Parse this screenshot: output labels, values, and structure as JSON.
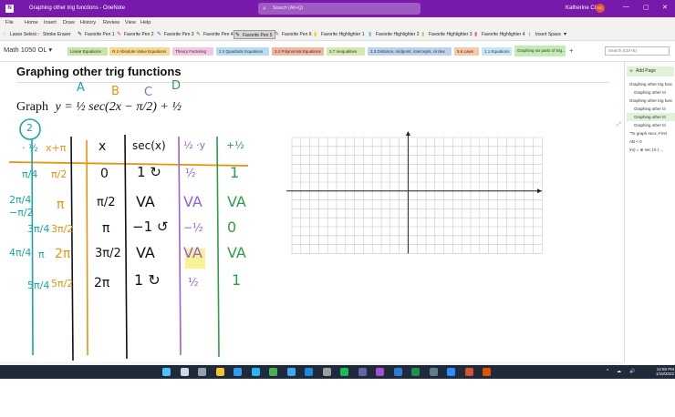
{
  "window": {
    "title": "Graphing other trig functions - OneNote",
    "app_badge": "N",
    "search_placeholder": "Search (Alt+Q)",
    "user": "Katherine Cliff",
    "user_initials": "KC",
    "minimize_glyph": "—",
    "maximize_glyph": "▢",
    "close_glyph": "✕"
  },
  "menu": [
    "File",
    "Home",
    "Insert",
    "Draw",
    "History",
    "Review",
    "View",
    "Help"
  ],
  "toolbar": {
    "tools": [
      {
        "label": "Lasso Select",
        "icon": "lasso-icon",
        "glyph": "◌",
        "color": "#444444"
      },
      {
        "label": "Stroke Eraser",
        "icon": "eraser-icon",
        "glyph": "▱",
        "color": "#d9534f"
      },
      {
        "label": "Favorite Pen 1",
        "icon": "pen-icon",
        "glyph": "✎",
        "color": "#111111"
      },
      {
        "label": "Favorite Pen 2",
        "icon": "pen-icon",
        "glyph": "✎",
        "color": "#c0392b"
      },
      {
        "label": "Favorite Pen 3",
        "icon": "pen-icon",
        "glyph": "✎",
        "color": "#1565c0"
      },
      {
        "label": "Favorite Pen 4",
        "icon": "pen-icon",
        "glyph": "✎",
        "color": "#2e7d32"
      },
      {
        "label": "Favorite Pen 5",
        "icon": "pen-icon",
        "glyph": "✎",
        "color": "#111111",
        "selected": true
      },
      {
        "label": "Favorite Pen 6",
        "icon": "pen-icon",
        "glyph": "✎",
        "color": "#c0392b"
      },
      {
        "label": "Favorite Highlighter 1",
        "icon": "highlighter-icon",
        "glyph": "▮",
        "color": "#f2d600"
      },
      {
        "label": "Favorite Highlighter 2",
        "icon": "highlighter-icon",
        "glyph": "▮",
        "color": "#5ec8f2"
      },
      {
        "label": "Favorite Highlighter 3",
        "icon": "highlighter-icon",
        "glyph": "▮",
        "color": "#9be15d"
      },
      {
        "label": "Favorite Highlighter 4",
        "icon": "highlighter-icon",
        "glyph": "▮",
        "color": "#f06292"
      },
      {
        "label": "Insert Space",
        "icon": "insert-space-icon",
        "glyph": "↕",
        "color": "#444444"
      }
    ],
    "more_glyph": "▾"
  },
  "notebook": {
    "title": "Math 1050 OL",
    "dropdown_glyph": "▾",
    "sections": [
      {
        "label": "Linear Equations",
        "color": "#c9e3a8"
      },
      {
        "label": "R.2 Absolute Value Equations",
        "color": "#f6d98a"
      },
      {
        "label": "Theory Factoring",
        "color": "#f5c6e0"
      },
      {
        "label": "2.2 Quadratic Equations",
        "color": "#b7dbf5"
      },
      {
        "label": "3.4 Polynomial Equations",
        "color": "#f3b7a1"
      },
      {
        "label": "3.7 Inequalities",
        "color": "#d4e8b2"
      },
      {
        "label": "3.3 Distance, midpoint, intercepts, circles",
        "color": "#bcd2f2"
      },
      {
        "label": "5.6 Laws",
        "color": "#f6c8a3"
      },
      {
        "label": "1.1 Equations",
        "color": "#c6e6f8"
      },
      {
        "label": "Graphing six parts of trig...",
        "color": "#c4eab5",
        "selected": true
      }
    ],
    "add_section_glyph": "+",
    "page_search_placeholder": "Search (Ctrl+E)"
  },
  "page": {
    "heading": "Graphing other trig functions",
    "problem_prefix": "Graph",
    "problem_equation": "y = ½ sec(2x − π/2) + ½",
    "ink": {
      "letters": [
        "A",
        "B",
        "C",
        "D"
      ],
      "circled_two": "2",
      "col_headers": [
        "· ½",
        "x+π",
        "x",
        "sec(x)",
        "½ ·y",
        "+½"
      ],
      "rows": [
        [
          "π/4",
          "π/2",
          "0",
          "1 ↻",
          "½",
          "1"
        ],
        [
          "−π/2",
          "π",
          "π/2",
          "VA",
          "VA",
          "VA"
        ],
        [
          "3π/4",
          "3π/2",
          "π",
          "−1 ↺",
          "−½",
          "0"
        ],
        [
          "π",
          "2π",
          "3π/2",
          "VA",
          "VA",
          "VA"
        ],
        [
          "5π/4",
          "5π/2",
          "2π",
          "1 ↻",
          "½",
          "1"
        ]
      ],
      "row_splits": [
        [
          "",
          "",
          "",
          "",
          "",
          ""
        ],
        [
          "2π/4",
          "",
          "",
          "",
          "",
          ""
        ],
        [
          "",
          "",
          "",
          "",
          "",
          ""
        ],
        [
          "4π/4",
          "",
          "",
          "",
          "",
          ""
        ],
        [
          "",
          "",
          "",
          "",
          "",
          ""
        ]
      ]
    }
  },
  "pages": {
    "add_page": "Add Page",
    "add_page_glyph": "+",
    "items": [
      {
        "label": "Graphing other trig func",
        "level": 0
      },
      {
        "label": "Graphing other tri",
        "level": 1
      },
      {
        "label": "Graphing other trig func",
        "level": 0
      },
      {
        "label": "Graphing other tri",
        "level": 1
      },
      {
        "label": "Graphing other tri",
        "level": 1,
        "selected": true
      },
      {
        "label": "Graphing other tri",
        "level": 1
      },
      {
        "label": "\"To graph secx, First",
        "level": 0
      },
      {
        "label": "AB < 0",
        "level": 0
      },
      {
        "label": "\\m) = ⊕ sec (X-) ...",
        "level": 0
      }
    ]
  },
  "taskbar": {
    "time": "12:55 PM",
    "date": "1/18/2022",
    "icons": [
      {
        "name": "start-icon",
        "color": "#4fc3f7"
      },
      {
        "name": "search-icon",
        "color": "#cfd8dc"
      },
      {
        "name": "task-view-icon",
        "color": "#90a4ae"
      },
      {
        "name": "file-explorer-icon",
        "color": "#f4c430"
      },
      {
        "name": "edge-icon",
        "color": "#2e9df0"
      },
      {
        "name": "store-icon",
        "color": "#29b6f6"
      },
      {
        "name": "chrome-icon",
        "color": "#4caf50"
      },
      {
        "name": "photos-icon",
        "color": "#42a5f5"
      },
      {
        "name": "outlook-icon",
        "color": "#1e88e5"
      },
      {
        "name": "settings-icon",
        "color": "#9e9e9e"
      },
      {
        "name": "spotify-icon",
        "color": "#1db954"
      },
      {
        "name": "teams-icon",
        "color": "#6264a7"
      },
      {
        "name": "onenote-icon",
        "color": "#a14fd3"
      },
      {
        "name": "word-icon",
        "color": "#2b7cd3"
      },
      {
        "name": "excel-icon",
        "color": "#1f8f4e"
      },
      {
        "name": "video-icon",
        "color": "#607d8b"
      },
      {
        "name": "zoom-icon",
        "color": "#2d8cff"
      },
      {
        "name": "powerpoint-icon",
        "color": "#d35230"
      },
      {
        "name": "mail-icon",
        "color": "#e65100"
      }
    ],
    "tray_glyphs": [
      "^",
      "☁",
      "🔊"
    ]
  },
  "colors": {
    "title_bar": "#7719aa",
    "ink_orange": "#e8930c",
    "ink_teal": "#19a6a6",
    "ink_purple": "#9c5fd6",
    "ink_green": "#2e9e46",
    "ink_black": "#111111",
    "highlight": "#f1ea3b"
  }
}
